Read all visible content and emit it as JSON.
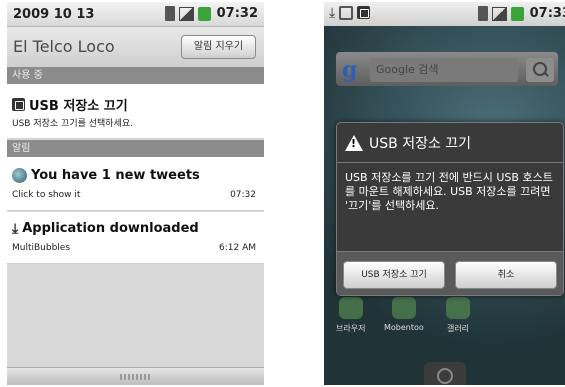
{
  "left": {
    "status_bar": {
      "date": "2009 10 13",
      "time": "07:32"
    },
    "carrier": "El Telco Loco",
    "clear_button": "알림 지우기",
    "ongoing_header": "사용 중",
    "ongoing_item": {
      "title": "USB 저장소 끄기",
      "subtitle": "USB 저장소 끄기를 선택하세요."
    },
    "notifications_header": "알림",
    "notifications": [
      {
        "title": "You have 1 new tweets",
        "subtitle": "Click to show it",
        "time": "07:32",
        "icon": "twitter-icon"
      },
      {
        "title": "Application downloaded",
        "subtitle": "MultiBubbles",
        "time": "6:12 AM",
        "icon": "download-icon"
      }
    ]
  },
  "right": {
    "status_bar": {
      "time": "07:33"
    },
    "search": {
      "logo": "g",
      "placeholder": "Google 검색"
    },
    "dialog": {
      "title": "USB 저장소 끄기",
      "body": "USB 저장소를 끄기 전에 반드시 USB 호스트를 마운트 해제하세요. USB 저장소를 끄려면 '끄기'를 선택하세요.",
      "ok_button": "USB 저장소 끄기",
      "cancel_button": "취소"
    },
    "apps": [
      {
        "label": "브라우저"
      },
      {
        "label": "Mobentoo"
      },
      {
        "label": "갤러리"
      }
    ]
  }
}
